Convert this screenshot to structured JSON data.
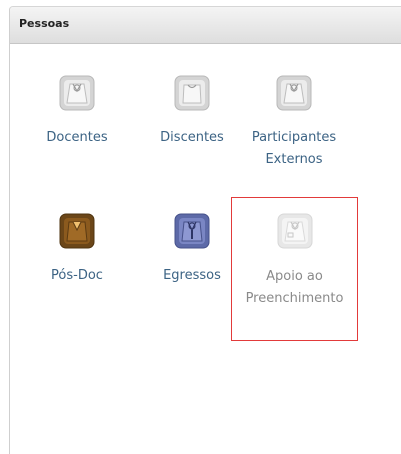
{
  "panel": {
    "title": "Pessoas"
  },
  "tiles": [
    {
      "label": "Docentes",
      "icon": "white-coat-icon",
      "color": "#e6e6e6"
    },
    {
      "label": "Discentes",
      "icon": "white-tshirt-icon",
      "color": "#e6e6e6"
    },
    {
      "label": "Participantes\nExternos",
      "icon": "white-coat-icon",
      "color": "#e6e6e6"
    },
    {
      "label": "Pós-Doc",
      "icon": "brown-coat-icon",
      "color": "#8b5a1e"
    },
    {
      "label": "Egressos",
      "icon": "blue-coat-icon",
      "color": "#7a86c4"
    },
    {
      "label": "Apoio ao\nPreenchimento",
      "icon": "white-coat-badge-icon",
      "color": "#e6e6e6",
      "selected": true
    }
  ],
  "colors": {
    "link": "#3c6384",
    "selected_border": "#e23a3a"
  }
}
